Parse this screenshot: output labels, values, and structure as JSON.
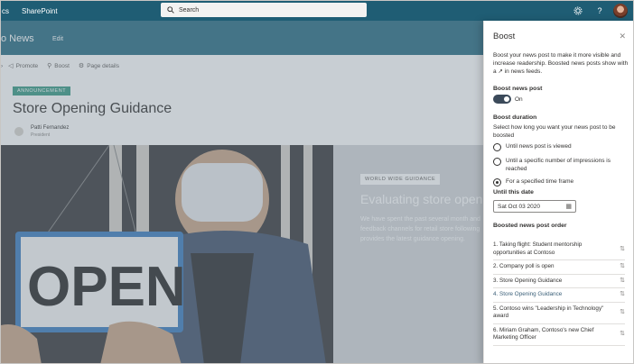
{
  "suite": {
    "app_fragment": "cs",
    "app_name": "SharePoint",
    "search_placeholder": "Search",
    "icons": [
      "settings-icon",
      "help-icon",
      "user-avatar"
    ]
  },
  "site": {
    "title": "o News",
    "edit": "Edit"
  },
  "commands": [
    {
      "icon": "promote-icon",
      "label": "Promote"
    },
    {
      "icon": "boost-icon",
      "label": "Boost"
    },
    {
      "icon": "page-details-icon",
      "label": "Page details"
    }
  ],
  "article": {
    "badge": "ANNOUNCEMENT",
    "title": "Store Opening Guidance",
    "author": "Patti Fernandez",
    "role": "President"
  },
  "hero": {
    "sign_text": "OPEN",
    "tag": "WORLD WIDE GUIDANCE",
    "title": "Evaluating store open",
    "body": "We have spent the past several month and feedback channels for retail store following provides the latest guidance opening."
  },
  "boost_panel": {
    "title": "Boost",
    "description": "Boost your news post to make it more visible and increase readership. Boosted news posts show with a ↗ in news feeds.",
    "boost_label": "Boost news post",
    "toggle_state": "On",
    "duration_label": "Boost duration",
    "duration_hint": "Select how long you want your news post to be boosted",
    "options": [
      {
        "label": "Until news post is viewed",
        "selected": false
      },
      {
        "label": "Until a specific number of impressions is reached",
        "selected": false
      },
      {
        "label": "For a specified time frame",
        "selected": true
      }
    ],
    "until_label": "Until this date",
    "until_value": "Sat Oct 03 2020",
    "order_label": "Boosted news post order",
    "order_items": [
      "1. Taking flight: Student mentorship opportunities at Contoso",
      "2. Company poll is open",
      "3. Store Opening Guidance",
      "4. Store Opening Guidance",
      "5. Contoso wins \"Leadership in Technology\" award",
      "6. Miriam Graham, Contoso's new Chief Marketing Officer"
    ],
    "selected_order_index": 3
  },
  "colors": {
    "suite_bar": "#1f5d74",
    "site_header": "#2a6e85",
    "badge": "#3a9c86",
    "toggle_on": "#3b4a5a"
  }
}
